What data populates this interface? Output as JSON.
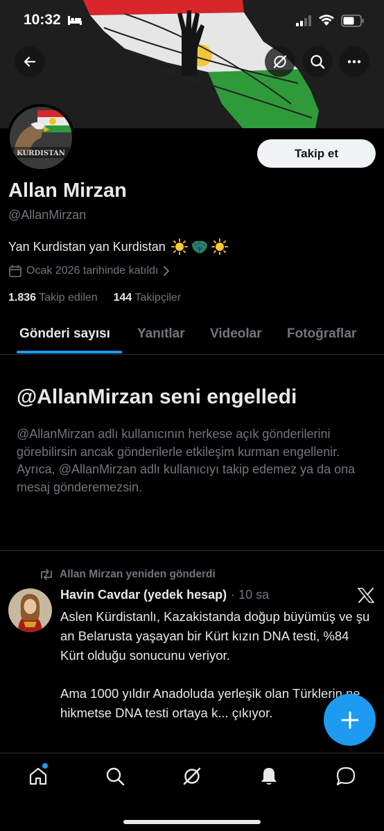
{
  "status_bar": {
    "time": "10:32"
  },
  "header": {
    "back_icon": "arrow-left-icon",
    "grok_icon": "grok-icon",
    "search_icon": "search-icon",
    "more_icon": "more-horizontal-icon"
  },
  "profile": {
    "avatar_text": "KURDISTAN",
    "follow_label": "Takip et",
    "display_name": "Allan Mirzan",
    "handle": "@AllanMirzan",
    "bio": "Yan Kurdistan yan Kurdistan",
    "bio_emojis": [
      "sun-emoji",
      "peacock-emoji",
      "sun-emoji"
    ],
    "joined": "Ocak 2026 tarihinde katıldı",
    "following_count": "1.836",
    "following_label": "Takip edilen",
    "followers_count": "144",
    "followers_label": "Takipçiler"
  },
  "tabs": [
    {
      "label": "Gönderi sayısı",
      "active": true
    },
    {
      "label": "Yanıtlar",
      "active": false
    },
    {
      "label": "Videolar",
      "active": false
    },
    {
      "label": "Fotoğraflar",
      "active": false
    }
  ],
  "blocked": {
    "title": "@AllanMirzan seni engelledi",
    "text": "@AllanMirzan adlı kullanıcının herkese açık gönderilerini görebilirsin ancak gönderilerle etkileşim kurman engellenir. Ayrıca, @AllanMirzan adlı kullanıcıyı takip edemez ya da ona mesaj gönderemezsin."
  },
  "post": {
    "repost_label": "Allan Mirzan yeniden gönderdi",
    "author_name": "Havin Cavdar (yedek hesap)",
    "time": "· 10 sa",
    "paragraph_1": "Aslen Kürdistanlı, Kazakistanda doğup büyümüş ve şu an Belarusta yaşayan bir Kürt kızın DNA testi, %84 Kürt olduğu sonucunu veriyor.",
    "paragraph_2": "Ama 1000 yıldır Anadoluda yerleşik olan Türklerin ne hikmetse DNA testi ortaya k... çıkıyor."
  },
  "bottom_nav": [
    "home-icon",
    "search-icon",
    "grok-icon",
    "bell-icon",
    "messages-icon"
  ],
  "colors": {
    "accent": "#1d9bf0",
    "background": "#000000",
    "text_primary": "#e7e9ea",
    "text_secondary": "#71767b",
    "divider": "#2f3336"
  }
}
